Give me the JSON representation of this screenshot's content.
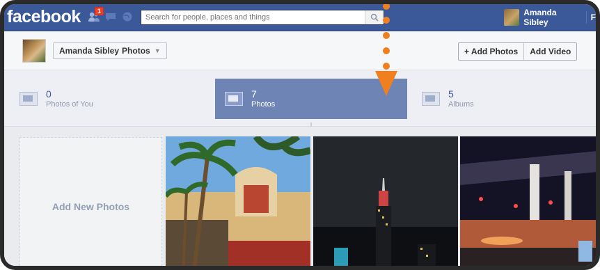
{
  "app": {
    "logo": "facebook"
  },
  "notifications": {
    "friend_requests_count": "1"
  },
  "search": {
    "placeholder": "Search for people, places and things"
  },
  "user": {
    "name": "Amanda Sibley",
    "next_label": "F"
  },
  "header": {
    "breadcrumb_name": "Amanda Sibley",
    "breadcrumb_section": "Photos",
    "add_photos_label": "+ Add Photos",
    "add_video_label": "Add Video"
  },
  "stats": [
    {
      "count": "0",
      "label": "Photos of You"
    },
    {
      "count": "7",
      "label": "Photos"
    },
    {
      "count": "5",
      "label": "Albums"
    }
  ],
  "grid": {
    "add_new_label": "Add New Photos"
  },
  "colors": {
    "brand_blue": "#3b5998",
    "active_tab": "#6d84b4",
    "annotation_orange": "#f0801f"
  }
}
